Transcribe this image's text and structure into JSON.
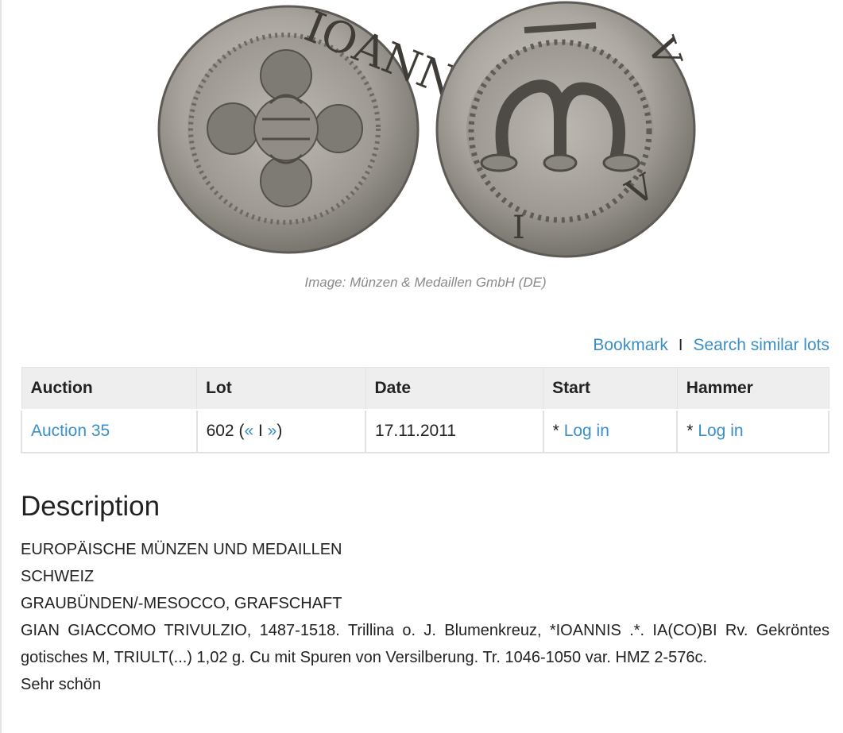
{
  "image": {
    "credit": "Image: Münzen & Medaillen GmbH (DE)",
    "obverse_legend": "IOANNIS",
    "reverse_letter": "M"
  },
  "actions": {
    "bookmark": "Bookmark",
    "separator": "I",
    "search_similar": "Search similar lots"
  },
  "table": {
    "headers": [
      "Auction",
      "Lot",
      "Date",
      "Start",
      "Hammer"
    ],
    "row": {
      "auction": "Auction 35",
      "lot_number": "602",
      "lot_open": "(",
      "lot_prev": "«",
      "lot_sep": "I",
      "lot_next": "»",
      "lot_close": ")",
      "date": "17.11.2011",
      "start_prefix": "*",
      "start_link": "Log in",
      "hammer_prefix": "*",
      "hammer_link": "Log in"
    }
  },
  "description": {
    "title": "Description",
    "lines": [
      "EUROPÄISCHE MÜNZEN UND MEDAILLEN",
      "SCHWEIZ",
      "GRAUBÜNDEN/-MESOCCO, GRAFSCHAFT",
      "GIAN GIACCOMO TRIVULZIO, 1487-1518. Trillina o. J. Blumenkreuz, *IOANNIS .*. IA(CO)BI Rv. Gekröntes gotisches M, TRIULT(...) 1,02 g. Cu mit Spuren von Versilberung. Tr. 1046-1050 var. HMZ 2-576c.",
      "Sehr schön"
    ]
  },
  "colors": {
    "link": "#3a8fc8",
    "header_bg": "#eeeeee",
    "border": "#e2e2e2",
    "credit_text": "#8a8a8a"
  }
}
